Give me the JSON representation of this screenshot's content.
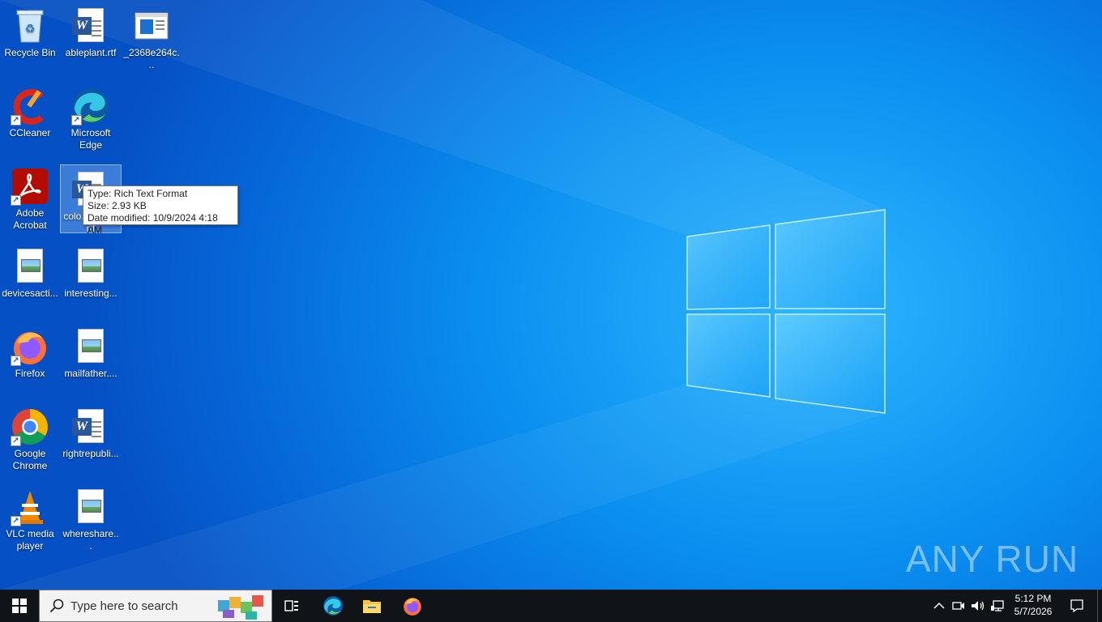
{
  "desktop": {
    "icons": [
      {
        "label": "Recycle Bin"
      },
      {
        "label": "ableplant.rtf"
      },
      {
        "label": "_2368e264c..."
      },
      {
        "label": "CCleaner"
      },
      {
        "label": "Microsoft Edge"
      },
      {
        "label": "Adobe Acrobat"
      },
      {
        "label": "colo...kages.rtf"
      },
      {
        "label": "devicesacti..."
      },
      {
        "label": "interesting..."
      },
      {
        "label": "Firefox"
      },
      {
        "label": "mailfather...."
      },
      {
        "label": "Google Chrome"
      },
      {
        "label": "rightrepubli..."
      },
      {
        "label": "VLC media player"
      },
      {
        "label": "whereshare..."
      }
    ],
    "tooltip": {
      "type": "Type: Rich Text Format",
      "size": "Size: 2.93 KB",
      "date": "Date modified: 10/9/2024 4:18 AM"
    },
    "watermark": "ANY RUN"
  },
  "taskbar": {
    "search_placeholder": "Type here to search",
    "clock_time": "5:12 PM",
    "clock_date": "5/7/2026"
  }
}
